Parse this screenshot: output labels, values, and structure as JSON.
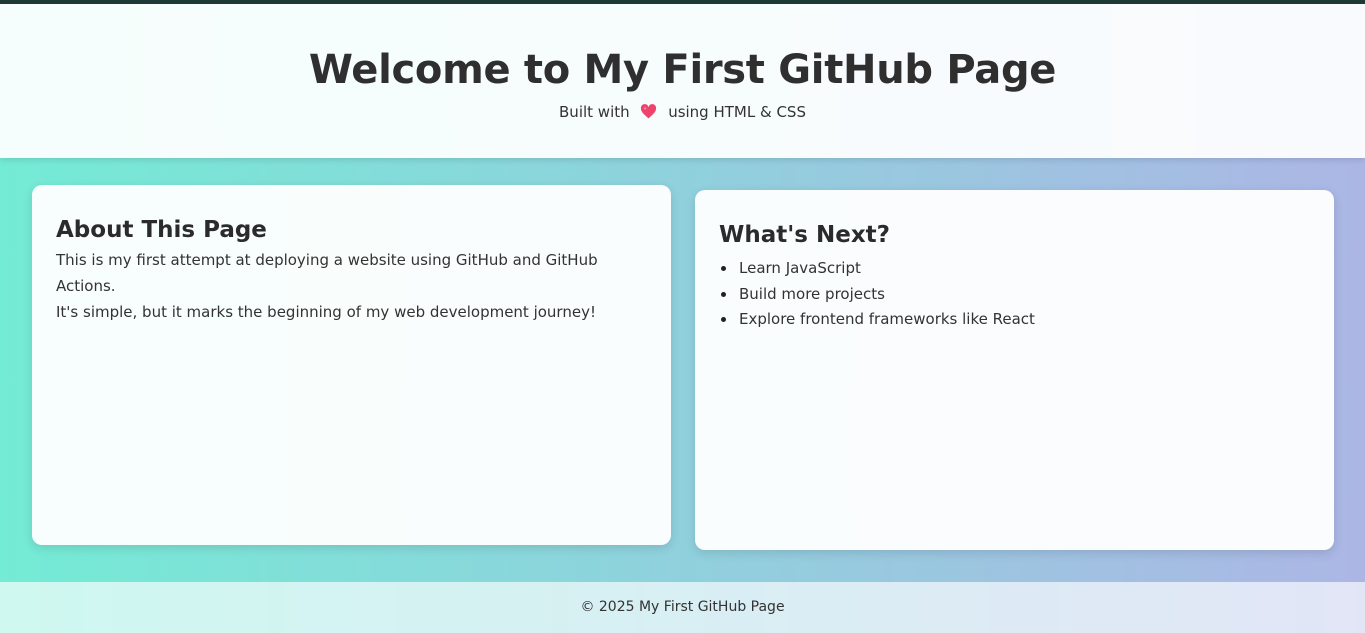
{
  "header": {
    "title": "Welcome to My First GitHub Page",
    "subtitle_before": "Built with",
    "subtitle_icon": "heart-icon",
    "subtitle_after": "using HTML & CSS"
  },
  "about": {
    "heading": "About This Page",
    "paragraph_1": "This is my first attempt at deploying a website using GitHub and GitHub Actions.",
    "paragraph_2": "It's simple, but it marks the beginning of my web development journey!"
  },
  "next": {
    "heading": "What's Next?",
    "items": [
      "Learn JavaScript",
      "Build more projects",
      "Explore frontend frameworks like React"
    ]
  },
  "footer": {
    "text": "© 2025 My First GitHub Page"
  },
  "colors": {
    "gradient_start": "#74ebd5",
    "gradient_end": "#ACB6E5",
    "heart": "#f0436b"
  }
}
